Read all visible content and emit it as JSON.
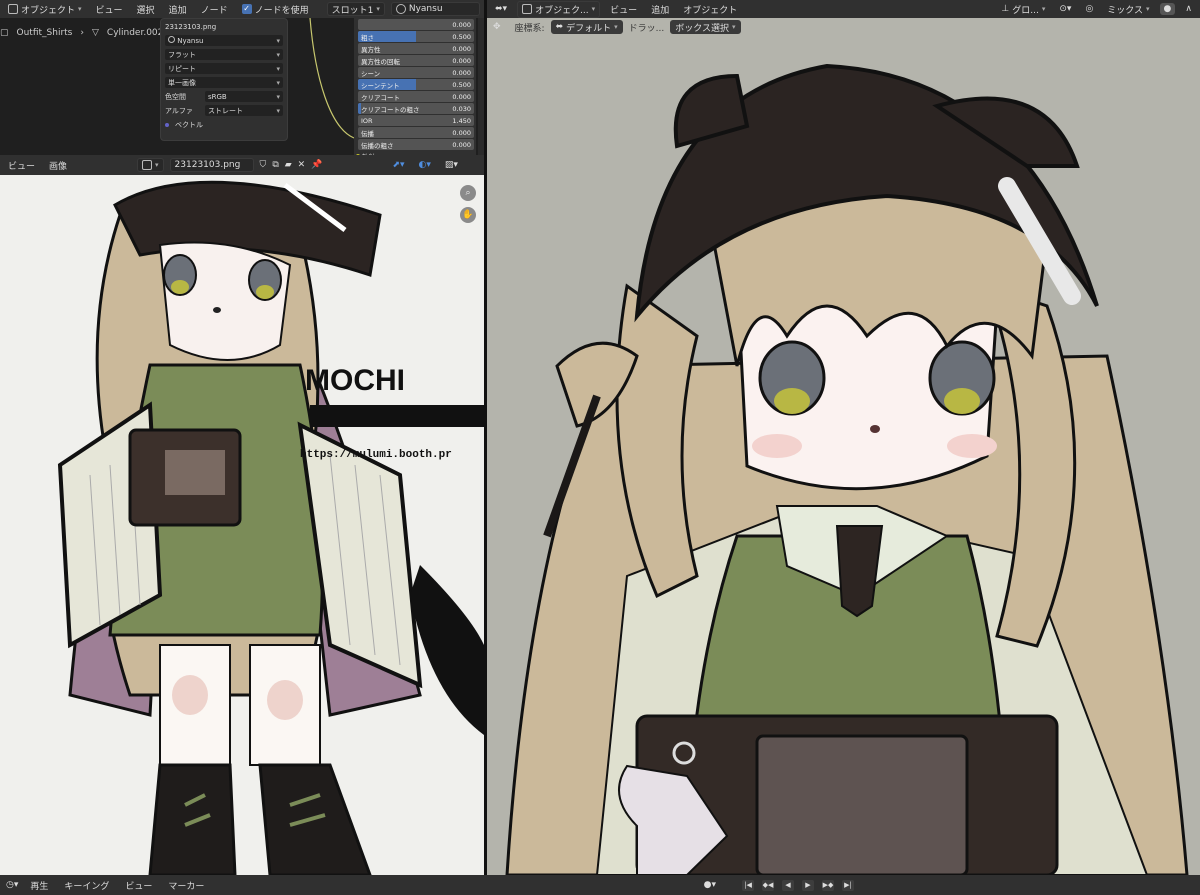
{
  "top_left_header": {
    "mode_label": "オブジェクト",
    "menu": [
      "ビュー",
      "選択",
      "追加",
      "ノード"
    ],
    "use_nodes_label": "ノードを使用",
    "slot_label": "スロット1",
    "material_name": "Nyansu"
  },
  "node_editor": {
    "breadcrumb_object": "Outfit_Shirts",
    "breadcrumb_mesh": "Cylinder.002",
    "image_node": {
      "image_name": "23123103.png",
      "material_field": "Nyansu",
      "interpolation": "フラット",
      "extension": "リピート",
      "projection": "単一画像",
      "color_space_label": "色空間",
      "color_space_value": "sRGB",
      "alpha_label": "アルファ",
      "alpha_value": "ストレート",
      "vector_label": "ベクトル"
    },
    "bsdf_props": [
      {
        "label": "",
        "value": "0.000",
        "fill": 0
      },
      {
        "label": "粗さ",
        "value": "0.500",
        "fill": 0.5
      },
      {
        "label": "異方性",
        "value": "0.000",
        "fill": 0
      },
      {
        "label": "異方性の回転",
        "value": "0.000",
        "fill": 0
      },
      {
        "label": "シーン",
        "value": "0.000",
        "fill": 0
      },
      {
        "label": "シーンテント",
        "value": "0.500",
        "fill": 0.5
      },
      {
        "label": "クリアコート",
        "value": "0.000",
        "fill": 0
      },
      {
        "label": "クリアコートの粗さ",
        "value": "0.030",
        "fill": 0.03
      },
      {
        "label": "IOR",
        "value": "1.450",
        "fill": 0
      },
      {
        "label": "伝播",
        "value": "0.000",
        "fill": 0
      },
      {
        "label": "伝播の粗さ",
        "value": "0.000",
        "fill": 0
      }
    ],
    "emission_label": "放射"
  },
  "image_editor_header": {
    "menu": [
      "ビュー",
      "画像"
    ],
    "image_name": "23123103.png"
  },
  "texture_text": {
    "brand": "MOCHI",
    "url": "https://mulumi.booth.pr"
  },
  "viewport_header": {
    "mode_label": "オブジェク...",
    "menu": [
      "ビュー",
      "追加",
      "オブジェクト"
    ],
    "transform_label": "グロ...",
    "shading_label": "ミックス"
  },
  "viewport_toolbar": {
    "orientation_label": "座標系:",
    "orientation_value": "デフォルト",
    "drag_label": "ドラッ...",
    "select_mode": "ボックス選択"
  },
  "timeline": {
    "menu": [
      "再生",
      "キーイング",
      "ビュー",
      "マーカー"
    ]
  },
  "colors": {
    "accent": "#4772b3",
    "hair": "#cbb99a",
    "vest": "#7b8c58",
    "hat": "#2b2422"
  }
}
